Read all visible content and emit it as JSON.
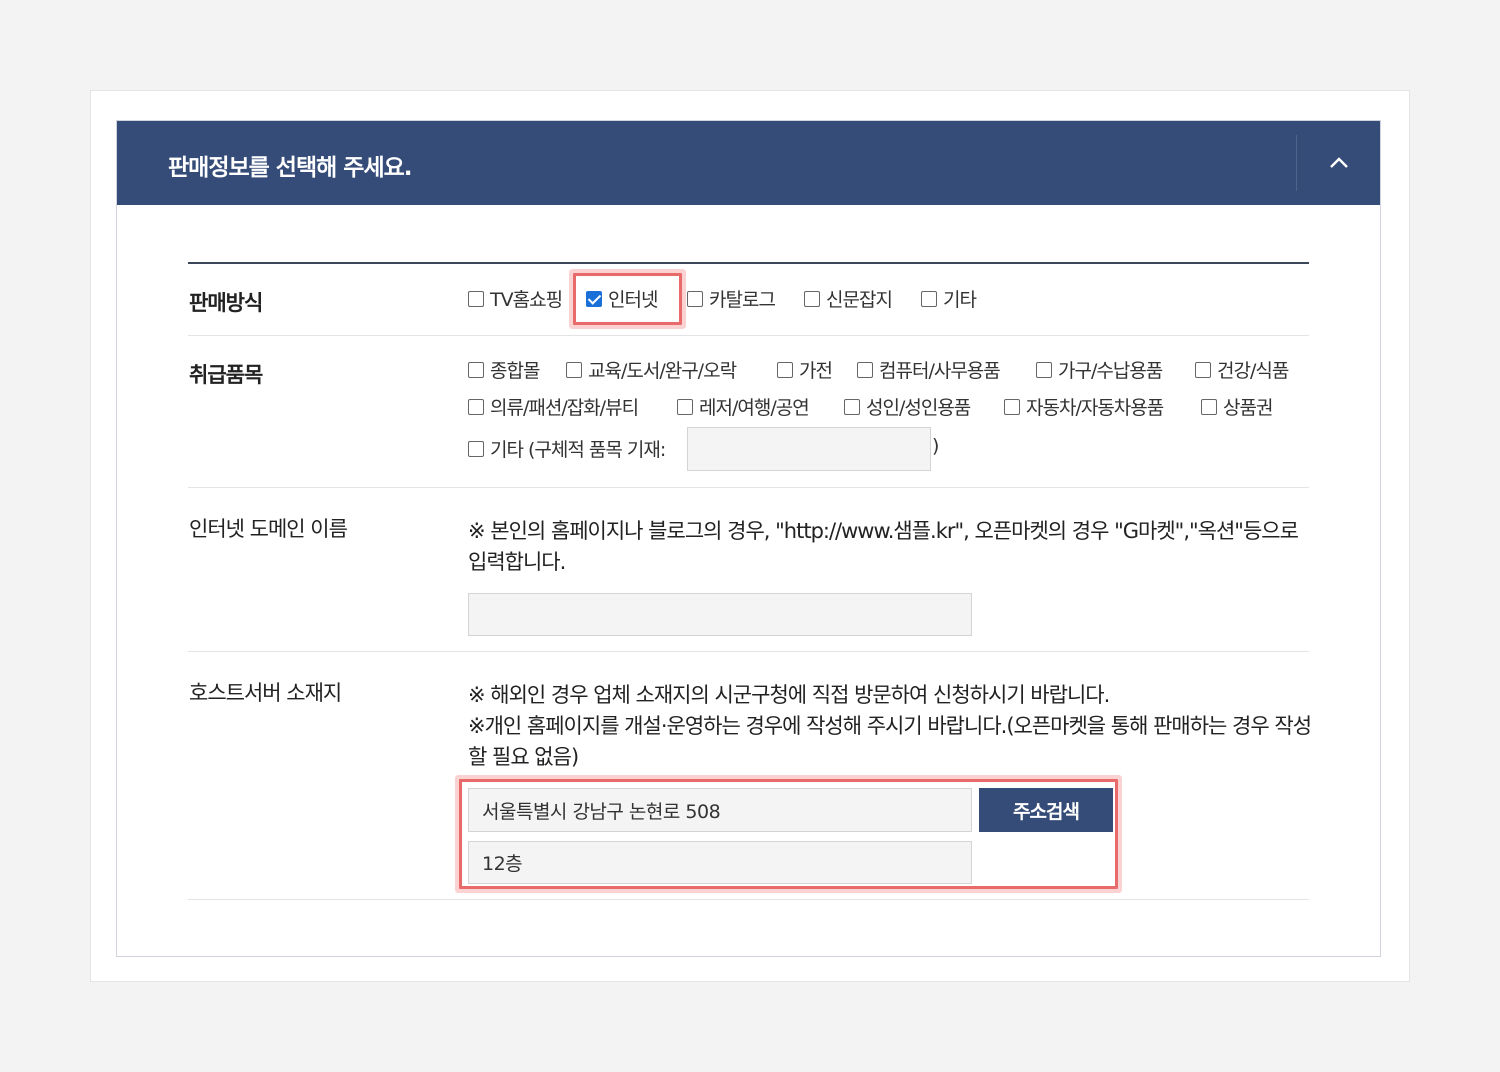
{
  "panel": {
    "title": "판매정보를 선택해 주세요.",
    "collapse_icon": "chevron-up-icon"
  },
  "sales_method": {
    "label": "판매방식",
    "options": [
      {
        "label": "TV홈쇼핑",
        "checked": false
      },
      {
        "label": "인터넷",
        "checked": true
      },
      {
        "label": "카탈로그",
        "checked": false
      },
      {
        "label": "신문잡지",
        "checked": false
      },
      {
        "label": "기타",
        "checked": false
      }
    ]
  },
  "items": {
    "label": "취급품목",
    "options": [
      {
        "label": "종합몰",
        "checked": false
      },
      {
        "label": "교육/도서/완구/오락",
        "checked": false
      },
      {
        "label": "가전",
        "checked": false
      },
      {
        "label": "컴퓨터/사무용품",
        "checked": false
      },
      {
        "label": "가구/수납용품",
        "checked": false
      },
      {
        "label": "건강/식품",
        "checked": false
      },
      {
        "label": "의류/패션/잡화/뷰티",
        "checked": false
      },
      {
        "label": "레저/여행/공연",
        "checked": false
      },
      {
        "label": "성인/성인용품",
        "checked": false
      },
      {
        "label": "자동차/자동차용품",
        "checked": false
      },
      {
        "label": "상품권",
        "checked": false
      }
    ],
    "other_label": "기타 (구체적 품목 기재:",
    "other_close": ")",
    "other_value": ""
  },
  "domain": {
    "label": "인터넷 도메인 이름",
    "notice": "※ 본인의 홈페이지나 블로그의 경우, \"http://www.샘플.kr\", 오픈마켓의 경우 \"G마켓\",\"옥션\"등으로 입력합니다.",
    "value": ""
  },
  "host": {
    "label": "호스트서버 소재지",
    "notice_1": "※ 해외인 경우 업체 소재지의 시군구청에 직접 방문하여 신청하시기 바랍니다.",
    "notice_2": "※개인 홈페이지를 개설·운영하는 경우에 작성해 주시기 바랍니다.(오픈마켓을 통해 판매하는 경우 작성할 필요 없음)",
    "address": "서울특별시 강남구 논현로 508",
    "address_detail": "12층",
    "search_button": "주소검색"
  },
  "colors": {
    "header_bg": "#354c78",
    "highlight": "#e86a6a",
    "checkbox_checked": "#1a6fd8"
  }
}
